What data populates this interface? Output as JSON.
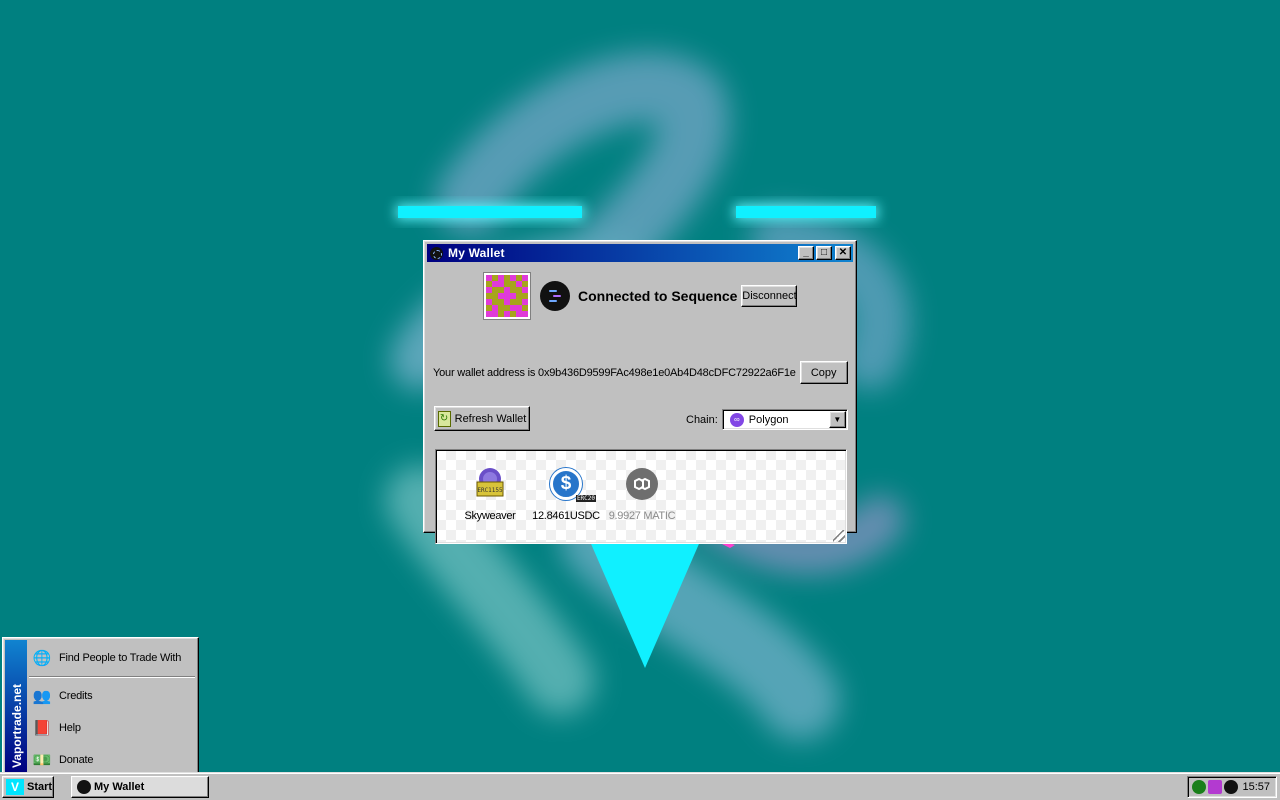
{
  "colors": {
    "desktop": "#008080",
    "title_bar_start": "#000080",
    "title_bar_end": "#1084d0",
    "polygon": "#8247e5",
    "usdc": "#2775ca",
    "logo_cyan": "#00e5ff"
  },
  "window": {
    "title": "My Wallet",
    "icon": "sequence-icon",
    "controls": {
      "minimize": "_",
      "maximize": "□",
      "close": "✕"
    }
  },
  "account": {
    "status": "Connected to Sequence",
    "disconnect_label": "Disconnect",
    "address_text": "Your wallet address is 0x9b436D9599FAc498e1e0Ab4D48cDFC72922a6F1e",
    "copy_label": "Copy"
  },
  "toolbar": {
    "refresh_label": "Refresh Wallet",
    "chain_label": "Chain:",
    "chain_selected": "Polygon",
    "dropdown_arrow": "▼"
  },
  "tokens": [
    {
      "label": "Skyweaver",
      "icon": "skyweaver-erc1155-icon",
      "badge": "ERC1155"
    },
    {
      "label": "12.8461USDC",
      "icon": "usdc-icon",
      "glyph": "$",
      "badge": "ERC20"
    },
    {
      "label": "9.9927 MATIC",
      "icon": "matic-icon"
    }
  ],
  "start_menu": {
    "banner": "Vaportrade.net",
    "items": [
      {
        "label": "Find People to Trade With",
        "icon": "globe-icon"
      },
      {
        "label": "Credits",
        "icon": "people-icon"
      },
      {
        "label": "Help",
        "icon": "book-icon"
      },
      {
        "label": "Donate",
        "icon": "money-icon"
      }
    ]
  },
  "taskbar": {
    "start_label": "Start",
    "start_logo": "V",
    "task_label": "My Wallet",
    "clock": "15:57"
  }
}
